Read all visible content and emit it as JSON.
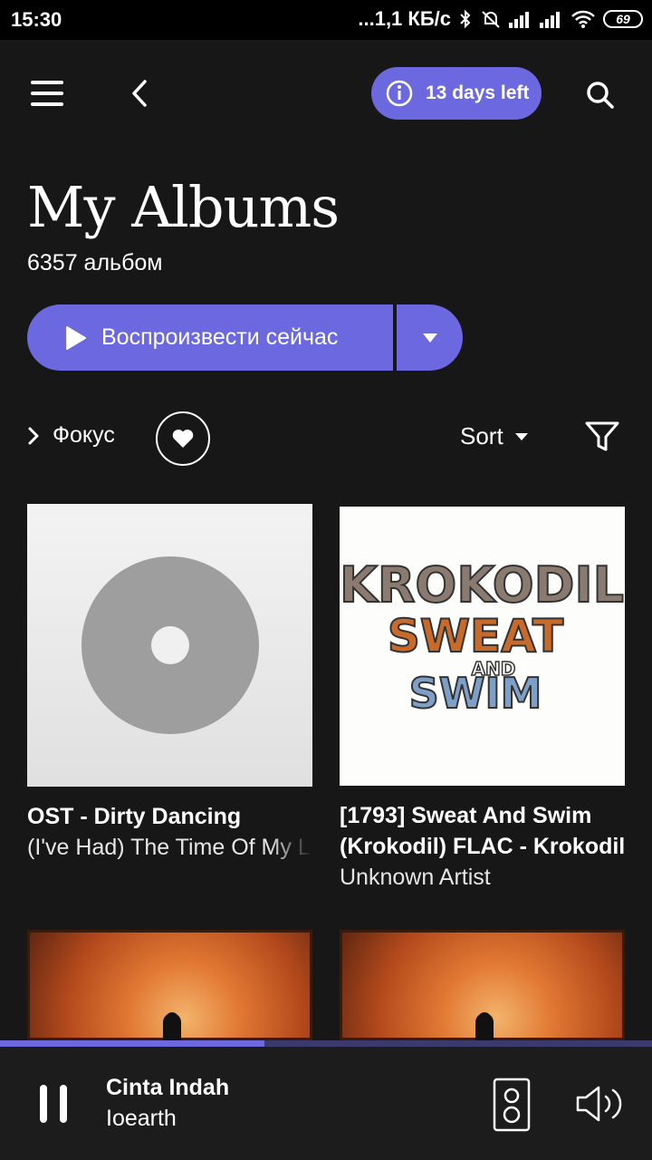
{
  "status_bar": {
    "time": "15:30",
    "network_speed": "...1,1 КБ/с",
    "battery": "69"
  },
  "top_bar": {
    "menu_icon": "menu-icon",
    "back_icon": "back-arrow-icon",
    "trial_label": "13 days left",
    "trial_icon": "info-icon",
    "search_icon": "search-icon"
  },
  "header": {
    "title": "My Albums",
    "count": "6357 альбом"
  },
  "play": {
    "label": "Воспроизвести сейчас",
    "accent": "#6b68e0"
  },
  "filters": {
    "focus_label": "Фокус",
    "sort_label": "Sort"
  },
  "albums": [
    {
      "title": "OST - Dirty Dancing",
      "subtitle": "(I've Had) The Time Of My Life"
    },
    {
      "title": "[1793] Sweat And Swim",
      "title2": "(Krokodil) FLAC - Krokodil",
      "subtitle": "Unknown Artist",
      "art_text": [
        "KROKODIL",
        "SWEAT",
        "AND",
        "SWIM"
      ]
    },
    {
      "title": "",
      "subtitle": ""
    },
    {
      "title": "",
      "subtitle": ""
    }
  ],
  "now_playing": {
    "title": "Cinta Indah",
    "artist": "Ioearth",
    "progress": 0.405
  }
}
